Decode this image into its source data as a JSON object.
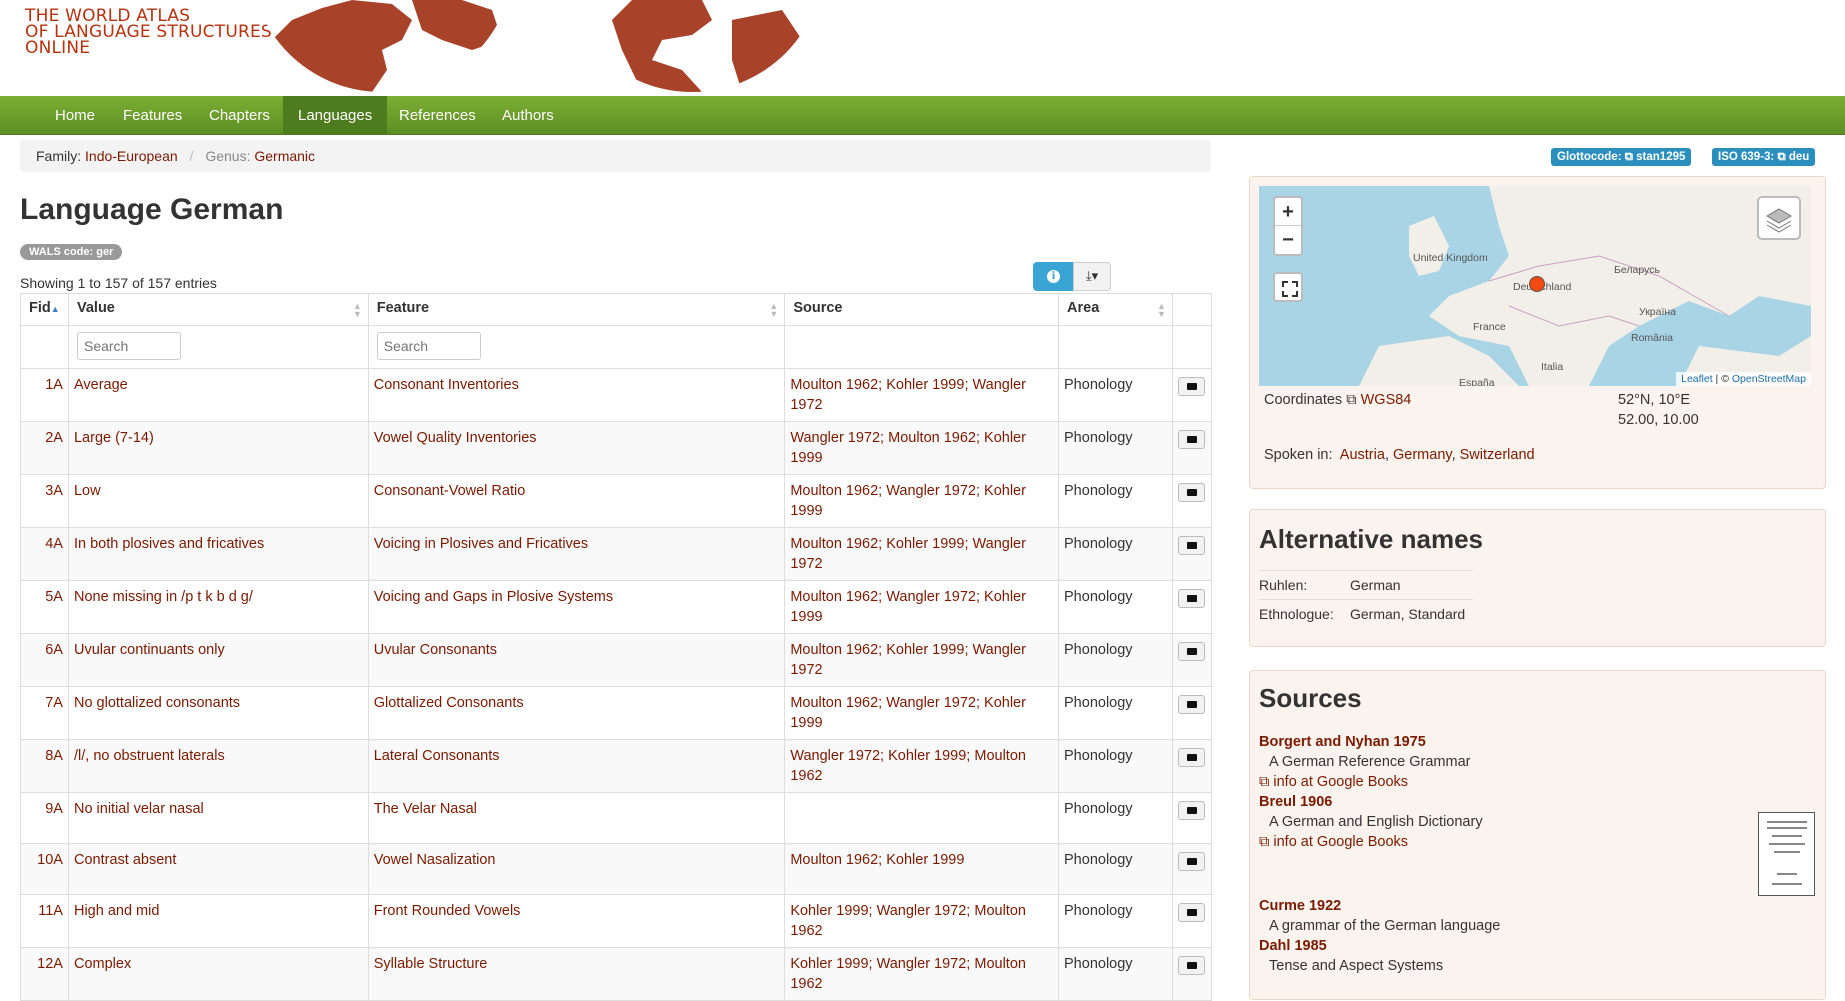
{
  "logo": {
    "line1": "THE WORLD ATLAS",
    "line2": "OF LANGUAGE STRUCTURES",
    "line3": "ONLINE"
  },
  "nav": {
    "items": [
      "Home",
      "Features",
      "Chapters",
      "Languages",
      "References",
      "Authors"
    ],
    "active": "Languages"
  },
  "breadcrumb": {
    "family_label": "Family:",
    "family": "Indo-European",
    "genus_label": "Genus:",
    "genus": "Germanic"
  },
  "identifiers": {
    "glottocode_label": "Glottocode:",
    "glottocode": "stan1295",
    "iso_label": "ISO 639-3:",
    "iso": "deu"
  },
  "page": {
    "title": "Language German",
    "wals_code": "WALS code: ger",
    "showing": "Showing 1 to 157 of 157 entries"
  },
  "table": {
    "columns": [
      "Fid",
      "Value",
      "Feature",
      "Source",
      "Area"
    ],
    "search_placeholder": "Search",
    "rows": [
      {
        "fid": "1A",
        "value": "Average",
        "feature": "Consonant Inventories",
        "source": "Moulton 1962; Kohler 1999; Wangler 1972",
        "area": "Phonology"
      },
      {
        "fid": "2A",
        "value": "Large (7-14)",
        "feature": "Vowel Quality Inventories",
        "source": "Wangler 1972; Moulton 1962; Kohler 1999",
        "area": "Phonology"
      },
      {
        "fid": "3A",
        "value": "Low",
        "feature": "Consonant-Vowel Ratio",
        "source": "Moulton 1962; Wangler 1972; Kohler 1999",
        "area": "Phonology"
      },
      {
        "fid": "4A",
        "value": "In both plosives and fricatives",
        "feature": "Voicing in Plosives and Fricatives",
        "source": "Moulton 1962; Kohler 1999; Wangler 1972",
        "area": "Phonology"
      },
      {
        "fid": "5A",
        "value": "None missing in /p t k b d g/",
        "feature": "Voicing and Gaps in Plosive Systems",
        "source": "Moulton 1962; Wangler 1972; Kohler 1999",
        "area": "Phonology"
      },
      {
        "fid": "6A",
        "value": "Uvular continuants only",
        "feature": "Uvular Consonants",
        "source": "Moulton 1962; Kohler 1999; Wangler 1972",
        "area": "Phonology"
      },
      {
        "fid": "7A",
        "value": "No glottalized consonants",
        "feature": "Glottalized Consonants",
        "source": "Moulton 1962; Wangler 1972; Kohler 1999",
        "area": "Phonology"
      },
      {
        "fid": "8A",
        "value": "/l/, no obstruent laterals",
        "feature": "Lateral Consonants",
        "source": "Wangler 1972; Kohler 1999; Moulton 1962",
        "area": "Phonology"
      },
      {
        "fid": "9A",
        "value": "No initial velar nasal",
        "feature": "The Velar Nasal",
        "source": "",
        "area": "Phonology"
      },
      {
        "fid": "10A",
        "value": "Contrast absent",
        "feature": "Vowel Nasalization",
        "source": "Moulton 1962; Kohler 1999",
        "area": "Phonology"
      },
      {
        "fid": "11A",
        "value": "High and mid",
        "feature": "Front Rounded Vowels",
        "source": "Kohler 1999; Wangler 1972; Moulton 1962",
        "area": "Phonology"
      },
      {
        "fid": "12A",
        "value": "Complex",
        "feature": "Syllable Structure",
        "source": "Kohler 1999; Wangler 1972; Moulton 1962",
        "area": "Phonology"
      }
    ]
  },
  "map": {
    "labels": [
      "United Kingdom",
      "Deutschland",
      "Беларусь",
      "France",
      "Україна",
      "România",
      "Italia",
      "España"
    ],
    "attribution_leaflet": "Leaflet",
    "attribution_sep": " | © ",
    "attribution_osm": "OpenStreetMap"
  },
  "coords": {
    "label": "Coordinates",
    "system": "WGS84",
    "dms": "52°N, 10°E",
    "decimal": "52.00, 10.00"
  },
  "spoken": {
    "label": "Spoken in:",
    "countries": [
      "Austria",
      "Germany",
      "Switzerland"
    ],
    "separator": ", "
  },
  "alt_names": {
    "heading": "Alternative names",
    "rows": [
      {
        "key": "Ruhlen:",
        "val": "German"
      },
      {
        "key": "Ethnologue:",
        "val": "German, Standard"
      }
    ]
  },
  "sources": {
    "heading": "Sources",
    "items": [
      {
        "title": "Borgert and Nyhan 1975",
        "desc": "A German Reference Grammar",
        "link": "info at Google Books"
      },
      {
        "title": "Breul 1906",
        "desc": "A German and English Dictionary",
        "link": "info at Google Books"
      },
      {
        "title": "Curme 1922",
        "desc": "A grammar of the German language",
        "link": ""
      },
      {
        "title": "Dahl 1985",
        "desc": "Tense and Aspect Systems",
        "link": ""
      }
    ]
  },
  "colors": {
    "nav_green": "#6c9e2c",
    "link": "#7a1a00",
    "badge_blue": "#2a8fbd",
    "map_sea": "#a9d4e6",
    "marker": "#f24a10"
  }
}
